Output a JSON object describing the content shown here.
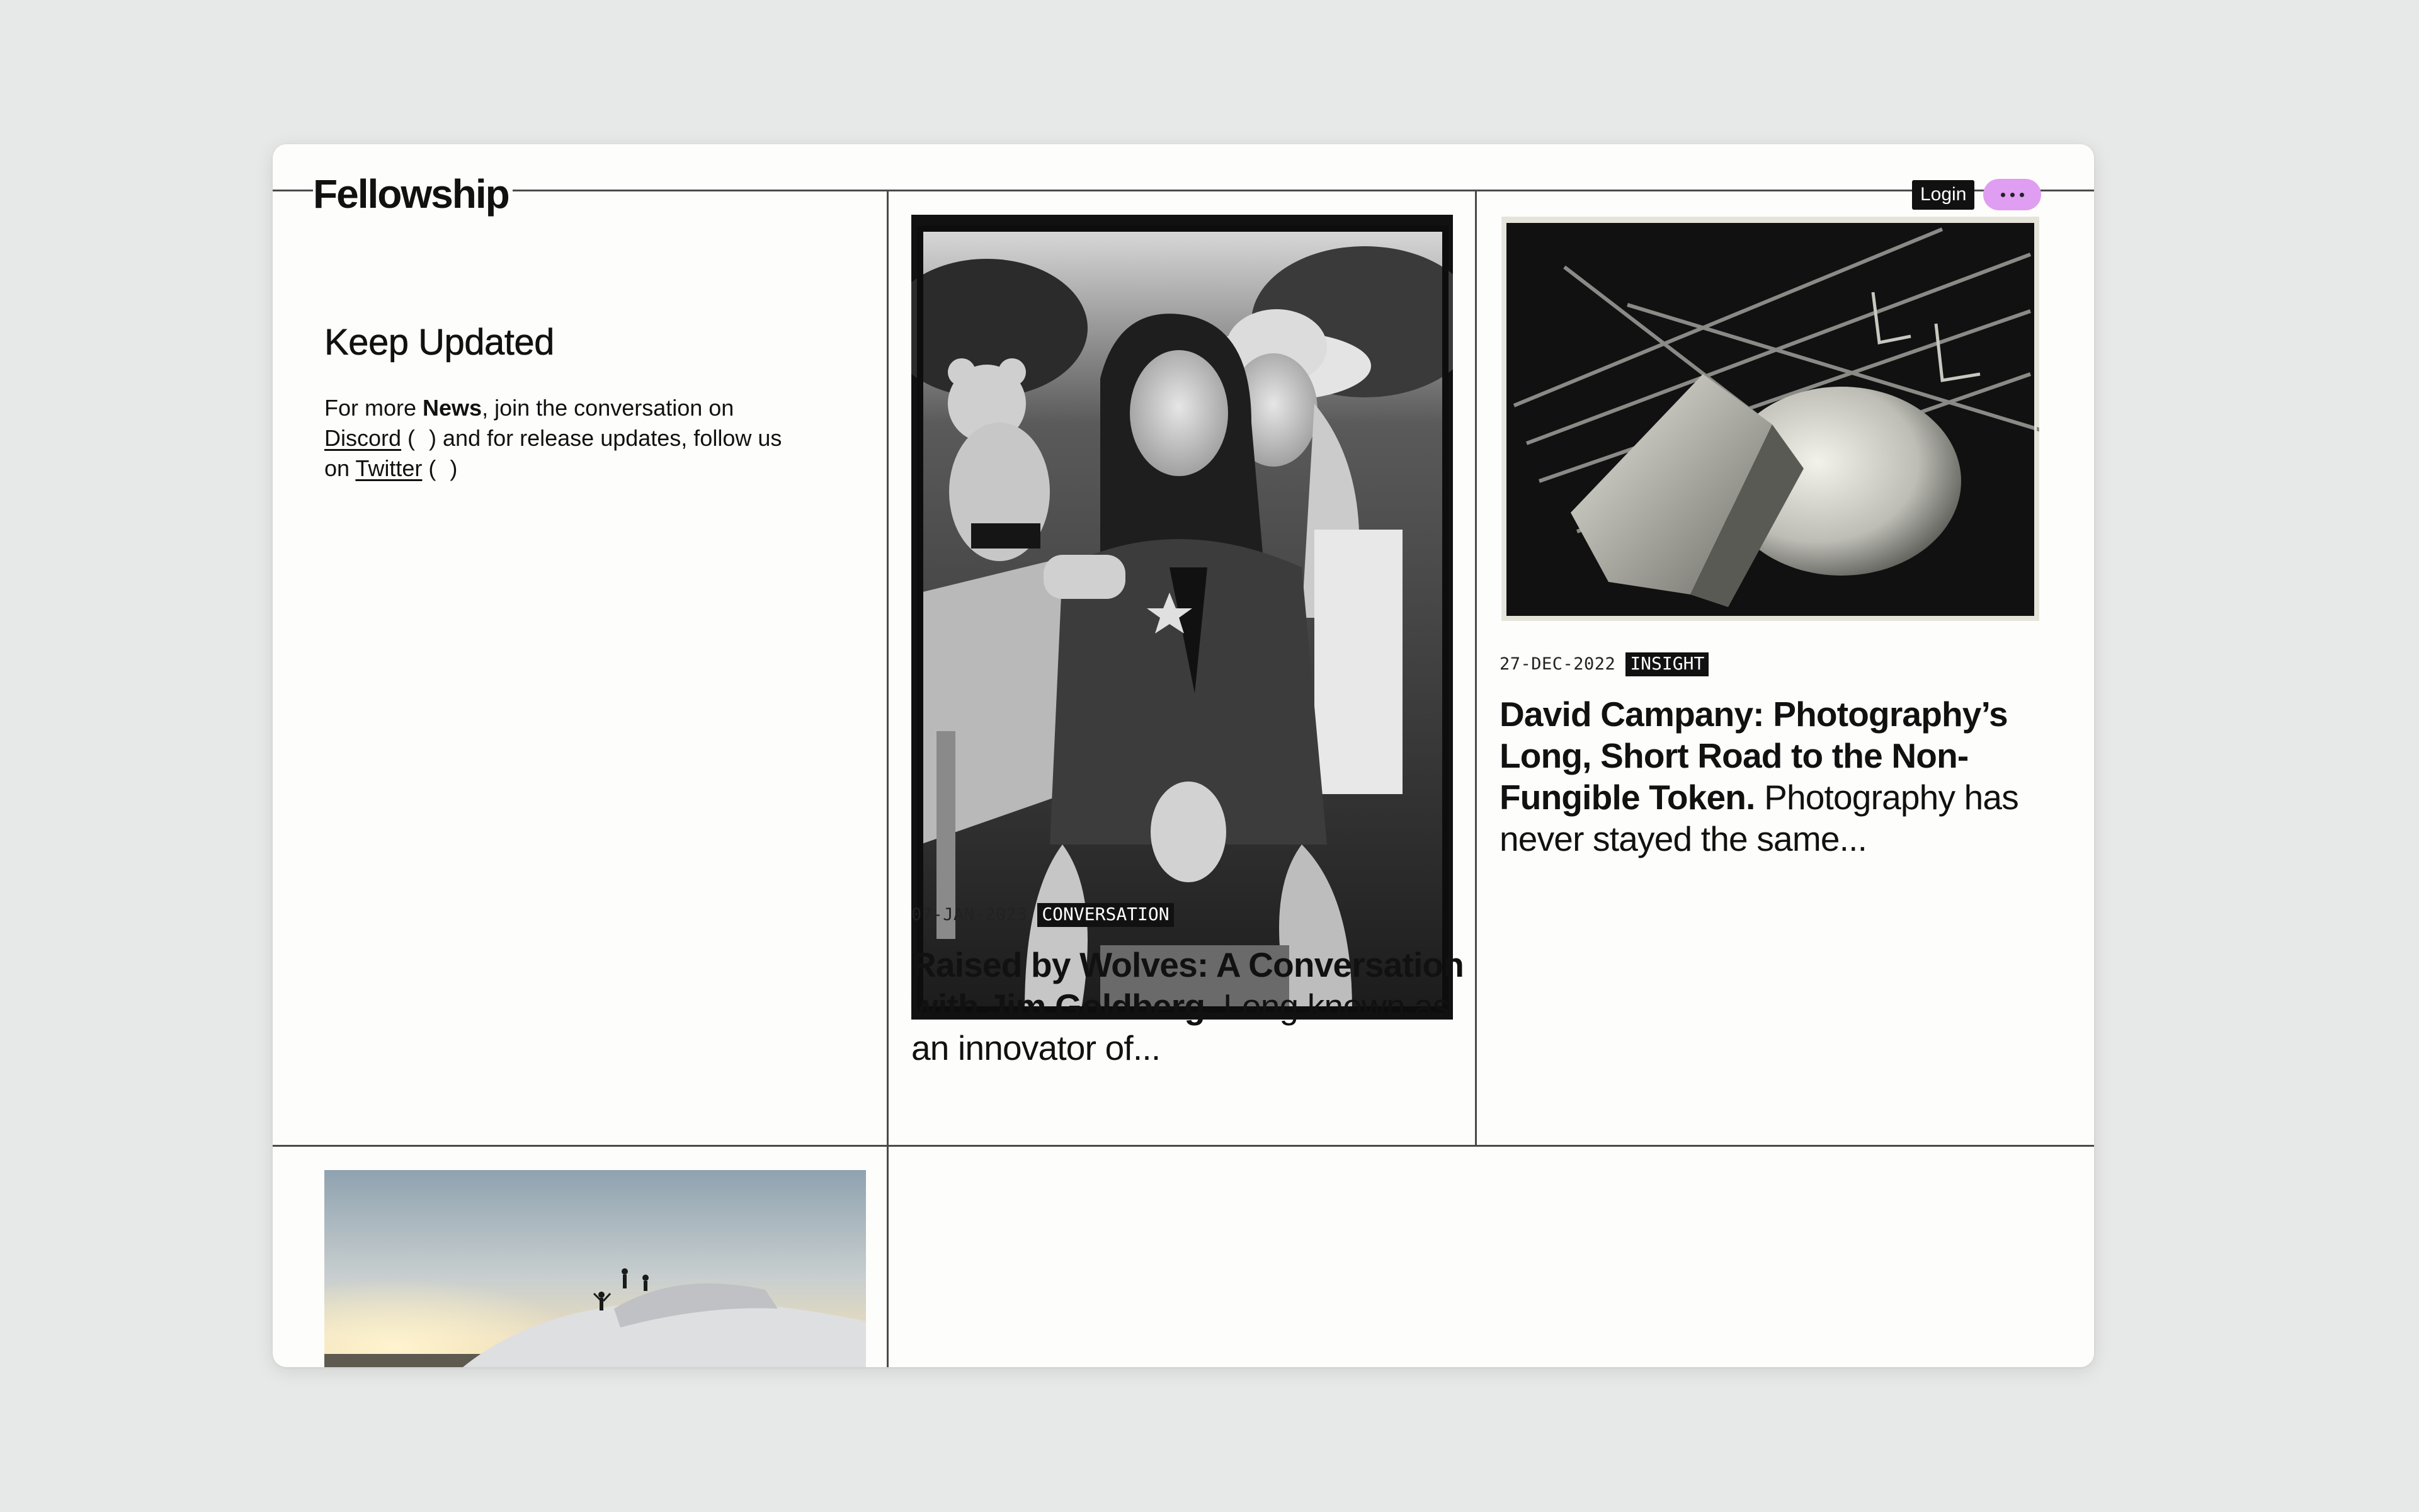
{
  "brand": {
    "logo_text": "Fellowship"
  },
  "header": {
    "login_label": "Login",
    "menu_icon": "more-dots-icon",
    "menu_color": "#df9ef1"
  },
  "keep_updated": {
    "title": "Keep Updated",
    "line_prefix": "For more ",
    "news_word": "News",
    "after_news": ", join the conversation on ",
    "discord_label": "Discord",
    "discord_icon": "external-link-icon",
    "middle": " and for release updates, follow us on ",
    "twitter_label": "Twitter",
    "twitter_icon": "external-link-icon"
  },
  "articles": [
    {
      "date": "07-JAN-2023",
      "tag": "CONVERSATION",
      "headline": "Raised by Wolves: A Conversation with Jim Goldberg.",
      "excerpt": "Long known as an innovator of..."
    },
    {
      "date": "27-DEC-2022",
      "tag": "INSIGHT",
      "headline": "David Campany: Photography’s Long, Short Road to the Non-Fungible Token.",
      "excerpt": "Photography has never stayed the same..."
    }
  ],
  "colors": {
    "background": "#e7e8e8",
    "panel": "#fdfdfb",
    "tag_bg": "#111111",
    "grid_line": "#4a4a4a"
  }
}
